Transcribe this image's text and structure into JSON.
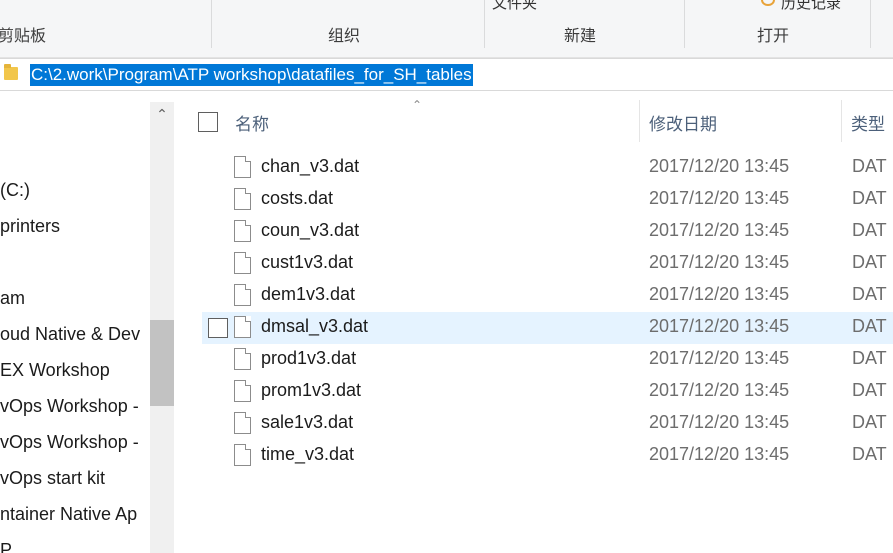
{
  "ribbon": {
    "top_partial": [
      "文件夹",
      "历史记录"
    ],
    "groups": [
      "剪贴板",
      "组织",
      "新建",
      "打开"
    ]
  },
  "address": {
    "path": "C:\\2.work\\Program\\ATP workshop\\datafiles_for_SH_tables"
  },
  "nav": {
    "items": [
      "(C:)",
      "printers",
      "am",
      "oud Native & Dev",
      "EX Workshop",
      "vOps Workshop -",
      "vOps Workshop -",
      "vOps start kit",
      "ntainer Native Ap",
      "P"
    ]
  },
  "columns": {
    "name": "名称",
    "modified": "修改日期",
    "type": "类型"
  },
  "files": [
    {
      "name": "chan_v3.dat",
      "modified": "2017/12/20 13:45",
      "type": "DAT"
    },
    {
      "name": "costs.dat",
      "modified": "2017/12/20 13:45",
      "type": "DAT"
    },
    {
      "name": "coun_v3.dat",
      "modified": "2017/12/20 13:45",
      "type": "DAT"
    },
    {
      "name": "cust1v3.dat",
      "modified": "2017/12/20 13:45",
      "type": "DAT"
    },
    {
      "name": "dem1v3.dat",
      "modified": "2017/12/20 13:45",
      "type": "DAT"
    },
    {
      "name": "dmsal_v3.dat",
      "modified": "2017/12/20 13:45",
      "type": "DAT"
    },
    {
      "name": "prod1v3.dat",
      "modified": "2017/12/20 13:45",
      "type": "DAT"
    },
    {
      "name": "prom1v3.dat",
      "modified": "2017/12/20 13:45",
      "type": "DAT"
    },
    {
      "name": "sale1v3.dat",
      "modified": "2017/12/20 13:45",
      "type": "DAT"
    },
    {
      "name": "time_v3.dat",
      "modified": "2017/12/20 13:45",
      "type": "DAT"
    }
  ],
  "colors": {
    "selection": "#0078d7",
    "hover_row": "#e5f3ff",
    "header_text": "#4c607a"
  }
}
